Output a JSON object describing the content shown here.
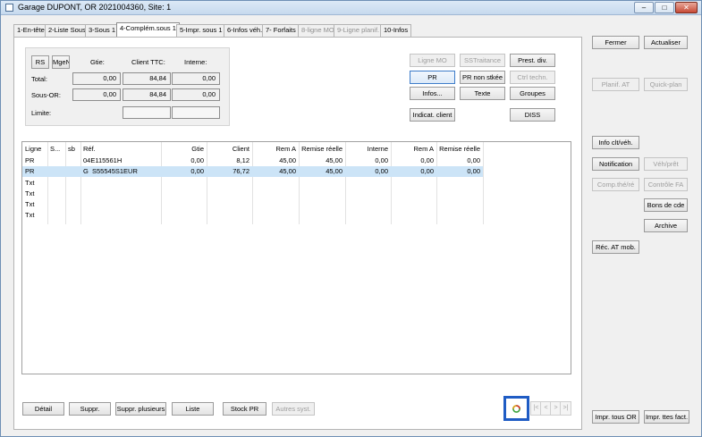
{
  "window": {
    "title": "Garage DUPONT, OR 2021004360, Site: 1"
  },
  "tabs": [
    {
      "label": "1-En-tête"
    },
    {
      "label": "2-Liste Sous"
    },
    {
      "label": "3-Sous 1"
    },
    {
      "label": "4-Complém.sous 1"
    },
    {
      "label": "5-Impr. sous 1"
    },
    {
      "label": "6-Infos véh."
    },
    {
      "label": "7- Forfaits"
    },
    {
      "label": "8-ligne MO"
    },
    {
      "label": "9-Ligne planif."
    },
    {
      "label": "10-Infos"
    }
  ],
  "totals": {
    "rs_label": "RS",
    "mgen_label": "MgeN",
    "col_gtie": "Gtie:",
    "col_client": "Client TTC:",
    "col_interne": "Interne:",
    "row_total": "Total:",
    "row_sous_or": "Sous-OR:",
    "row_limite": "Limite:",
    "total_gtie": "0,00",
    "total_client": "84,84",
    "total_interne": "0,00",
    "sousor_gtie": "0,00",
    "sousor_client": "84,84",
    "sousor_interne": "0,00"
  },
  "actions": {
    "ligne_mo": "Ligne MO",
    "sstraitance": "SSTraitance",
    "prest_div": "Prest. div.",
    "pr": "PR",
    "pr_non_stkee": "PR non stkée",
    "ctrl_techn": "Ctrl techn.",
    "infos": "Infos...",
    "texte": "Texte",
    "groupes": "Groupes",
    "indicat_client": "Indicat. client",
    "diss": "DISS"
  },
  "grid": {
    "headers": [
      "Ligne",
      "S...",
      "sb",
      "Réf.",
      "Gtie",
      "Client",
      "Rem A",
      "Remise réelle",
      "Interne",
      "Rem A",
      "Remise réelle"
    ],
    "rows": [
      [
        "PR",
        "",
        "",
        "04E115561H",
        "0,00",
        "8,12",
        "45,00",
        "45,00",
        "0,00",
        "0,00",
        "0,00"
      ],
      [
        "PR",
        "",
        "",
        "G  S55545S1EUR",
        "0,00",
        "76,72",
        "45,00",
        "45,00",
        "0,00",
        "0,00",
        "0,00"
      ],
      [
        "Txt",
        "",
        "",
        "",
        "",
        "",
        "",
        "",
        "",
        "",
        ""
      ],
      [
        "Txt",
        "",
        "",
        "",
        "",
        "",
        "",
        "",
        "",
        "",
        ""
      ],
      [
        "Txt",
        "",
        "",
        "",
        "",
        "",
        "",
        "",
        "",
        "",
        ""
      ],
      [
        "Txt",
        "",
        "",
        "",
        "",
        "",
        "",
        "",
        "",
        "",
        ""
      ]
    ]
  },
  "bottom": {
    "detail": "Détail",
    "suppr": "Suppr.",
    "suppr_plusieurs": "Suppr. plusieurs",
    "liste": "Liste",
    "stock_pr": "Stock PR",
    "autres_syst": "Autres syst.",
    "nav_first": "|<",
    "nav_prev": "<",
    "nav_next": ">",
    "nav_last": ">|"
  },
  "side": {
    "fermer": "Fermer",
    "actualiser": "Actualiser",
    "planif_at": "Planif. AT",
    "quick_plan": "Quick-plan",
    "info_clt_veh": "Info clt/véh.",
    "notification": "Notification",
    "veh_pret": "Véh/prêt",
    "comp_the_re": "Comp.thé/ré",
    "controle_fa": "Contrôle FA",
    "bons_de_cde": "Bons de cde",
    "archive": "Archive",
    "rec_at_mob": "Réc. AT mob.",
    "impr_tous_or": "Impr. tous OR",
    "impr_ttes_fact": "Impr. ttes fact."
  },
  "colors": {
    "highlight": "#1f5cc4",
    "selected_row": "#cce4f7",
    "accent": "#3d7cc9"
  },
  "icons": {
    "refresh": "refresh-icon",
    "app": "app-icon"
  }
}
